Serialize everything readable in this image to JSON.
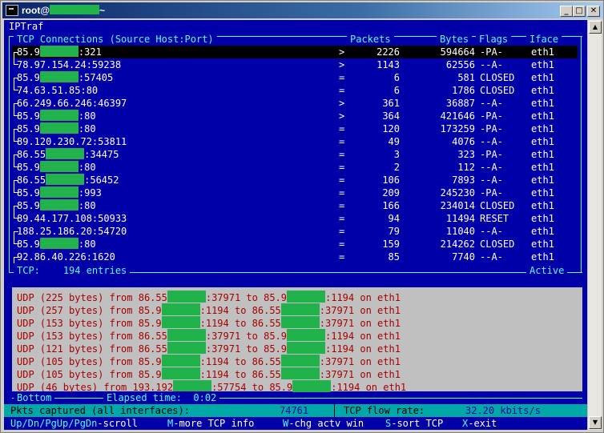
{
  "window": {
    "title_prefix": "root@",
    "title_suffix": "~",
    "minimize": "_",
    "maximize": "□",
    "close": "✕"
  },
  "app_name": "IPTraf",
  "tcp": {
    "header_connections": "TCP Connections (Source Host:Port)",
    "header_packets": "Packets",
    "header_bytes": "Bytes",
    "header_flags": "Flags",
    "header_iface": "Iface",
    "rows": [
      {
        "host_pre": "85.9",
        "host_post": ":321",
        "dir": ">",
        "packets": "2226",
        "bytes": "594664",
        "flags": "-PA-",
        "iface": "eth1",
        "selected": true,
        "bracket": "start"
      },
      {
        "host_pre": "78.97.154.24:59238",
        "host_post": "",
        "dir": ">",
        "packets": "1143",
        "bytes": "62556",
        "flags": "--A-",
        "iface": "eth1",
        "bracket": "end"
      },
      {
        "host_pre": "85.9",
        "host_post": ":57405",
        "dir": "=",
        "packets": "6",
        "bytes": "581",
        "flags": "CLOSED",
        "iface": "eth1",
        "bracket": "start"
      },
      {
        "host_pre": "74.63.51.85:80",
        "host_post": "",
        "dir": "=",
        "packets": "6",
        "bytes": "1786",
        "flags": "CLOSED",
        "iface": "eth1",
        "bracket": "end"
      },
      {
        "host_pre": "66.249.66.246:46397",
        "host_post": "",
        "dir": ">",
        "packets": "361",
        "bytes": "36887",
        "flags": "--A-",
        "iface": "eth1",
        "bracket": "start"
      },
      {
        "host_pre": "85.9",
        "host_post": ":80",
        "dir": ">",
        "packets": "364",
        "bytes": "421646",
        "flags": "-PA-",
        "iface": "eth1",
        "bracket": "end"
      },
      {
        "host_pre": "85.9",
        "host_post": ":80",
        "dir": "=",
        "packets": "120",
        "bytes": "173259",
        "flags": "-PA-",
        "iface": "eth1",
        "bracket": "start"
      },
      {
        "host_pre": "89.120.230.72:53811",
        "host_post": "",
        "dir": "=",
        "packets": "49",
        "bytes": "4076",
        "flags": "--A-",
        "iface": "eth1",
        "bracket": "end"
      },
      {
        "host_pre": "86.55",
        "host_post": ":34475",
        "dir": "=",
        "packets": "3",
        "bytes": "323",
        "flags": "-PA-",
        "iface": "eth1",
        "bracket": "start"
      },
      {
        "host_pre": "85.9",
        "host_post": ":80",
        "dir": "=",
        "packets": "2",
        "bytes": "112",
        "flags": "--A-",
        "iface": "eth1",
        "bracket": "end"
      },
      {
        "host_pre": "86.55",
        "host_post": ":56452",
        "dir": "=",
        "packets": "106",
        "bytes": "7893",
        "flags": "--A-",
        "iface": "eth1",
        "bracket": "start"
      },
      {
        "host_pre": "85.9",
        "host_post": ":993",
        "dir": "=",
        "packets": "209",
        "bytes": "245230",
        "flags": "-PA-",
        "iface": "eth1",
        "bracket": "end"
      },
      {
        "host_pre": "85.9",
        "host_post": ":80",
        "dir": "=",
        "packets": "166",
        "bytes": "234014",
        "flags": "CLOSED",
        "iface": "eth1",
        "bracket": "start"
      },
      {
        "host_pre": "89.44.177.108:50933",
        "host_post": "",
        "dir": "=",
        "packets": "94",
        "bytes": "11494",
        "flags": "RESET",
        "iface": "eth1",
        "bracket": "end"
      },
      {
        "host_pre": "188.25.186.20:54720",
        "host_post": "",
        "dir": "=",
        "packets": "79",
        "bytes": "11040",
        "flags": "--A-",
        "iface": "eth1",
        "bracket": "start"
      },
      {
        "host_pre": "85.9",
        "host_post": ":80",
        "dir": "=",
        "packets": "159",
        "bytes": "214262",
        "flags": "CLOSED",
        "iface": "eth1",
        "bracket": "end"
      },
      {
        "host_pre": "92.86.40.226:1620",
        "host_post": "",
        "dir": "=",
        "packets": "85",
        "bytes": "7740",
        "flags": "--A-",
        "iface": "eth1",
        "bracket": "start"
      }
    ],
    "footer_label": "TCP:",
    "footer_entries": "194 entries",
    "footer_status": "Active"
  },
  "udp": {
    "lines": [
      {
        "a": "UDP (225 bytes) from 86.55",
        "b": ":37971 to 85.9",
        "c": ":1194 on eth1"
      },
      {
        "a": "UDP (257 bytes) from 85.9",
        "b": ":1194 to 86.55",
        "c": ":37971 on eth1"
      },
      {
        "a": "UDP (153 bytes) from 85.9",
        "b": ":1194 to 86.55",
        "c": ":37971 on eth1"
      },
      {
        "a": "UDP (153 bytes) from 86.55",
        "b": ":37971 to 85.9",
        "c": ":1194 on eth1"
      },
      {
        "a": "UDP (121 bytes) from 86.55",
        "b": ":37971 to 85.9",
        "c": ":1194 on eth1"
      },
      {
        "a": "UDP (105 bytes) from 85.9",
        "b": ":1194 to 86.55",
        "c": ":37971 on eth1"
      },
      {
        "a": "UDP (105 bytes) from 85.9",
        "b": ":1194 to 86.55",
        "c": ":37971 on eth1"
      },
      {
        "a": "UDP (46 bytes) from 193.192",
        "b": ":57754 to 85.9",
        "c": ":1194 on eth1"
      }
    ],
    "footer_position": "Bottom",
    "footer_elapsed_label": "Elapsed time:",
    "footer_elapsed": "0:02"
  },
  "status": {
    "pkts_label": "Pkts captured (all interfaces):",
    "pkts_value": "74761",
    "flow_label": "TCP flow rate:",
    "flow_value": "32.20 kbits/s"
  },
  "commands": [
    {
      "key": "Up/Dn/PgUp/PgDn",
      "desc": "-scroll"
    },
    {
      "key": "M",
      "desc": "-more TCP info"
    },
    {
      "key": "W",
      "desc": "-chg actv win"
    },
    {
      "key": "S",
      "desc": "-sort TCP"
    },
    {
      "key": "X",
      "desc": "-exit"
    }
  ],
  "colors": {
    "console_bg": "#0000a8",
    "mask": "#21b24b",
    "accent": "#55ffff",
    "udp_text": "#a80000"
  }
}
